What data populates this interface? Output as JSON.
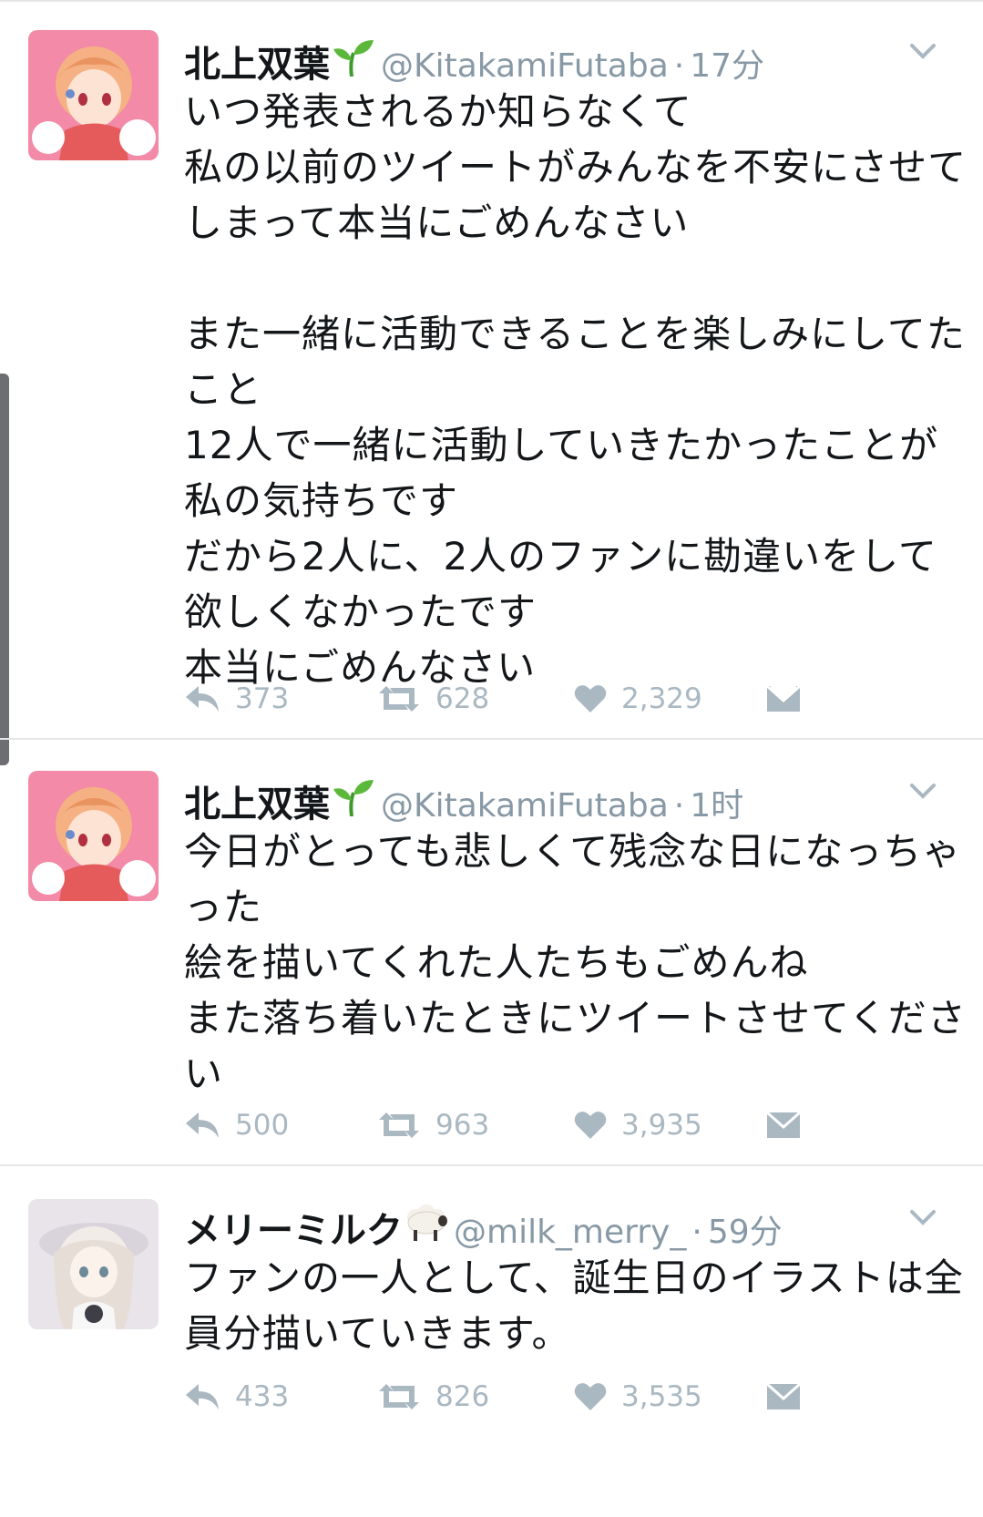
{
  "tweets": [
    {
      "name": "北上双葉",
      "name_emoji": "seedling-emoji",
      "handle": "@KitakamiFutaba",
      "separator": "·",
      "time": "17分",
      "text": "いつ発表されるか知らなくて\n私の以前のツイートがみんなを不安にさせてしまって本当にごめんなさい\n\nまた一緒に活動できることを楽しみにしてたこと\n12人で一緒に活動していきたかったことが私の気持ちです\nだから2人に、2人のファンに勘違いをして欲しくなかったです\n本当にごめんなさい",
      "replies": "373",
      "retweets": "628",
      "likes": "2,329"
    },
    {
      "name": "北上双葉",
      "name_emoji": "seedling-emoji",
      "handle": "@KitakamiFutaba",
      "separator": "·",
      "time": "1时",
      "text": "今日がとっても悲しくて残念な日になっちゃった\n絵を描いてくれた人たちもごめんね\nまた落ち着いたときにツイートさせてください",
      "replies": "500",
      "retweets": "963",
      "likes": "3,935"
    },
    {
      "name": "メリーミルク",
      "name_emoji": "sheep-emoji",
      "handle": "@milk_merry_",
      "separator": "·",
      "time": "59分",
      "text": "ファンの一人として、誕生日のイラストは全員分描いていきます。",
      "replies": "433",
      "retweets": "826",
      "likes": "3,535"
    }
  ],
  "colors": {
    "text": "#14171a",
    "muted": "#8899a6",
    "icon": "#aab8c2",
    "divider": "#e4e6e8",
    "avatar_pink": "#f28aa8"
  }
}
